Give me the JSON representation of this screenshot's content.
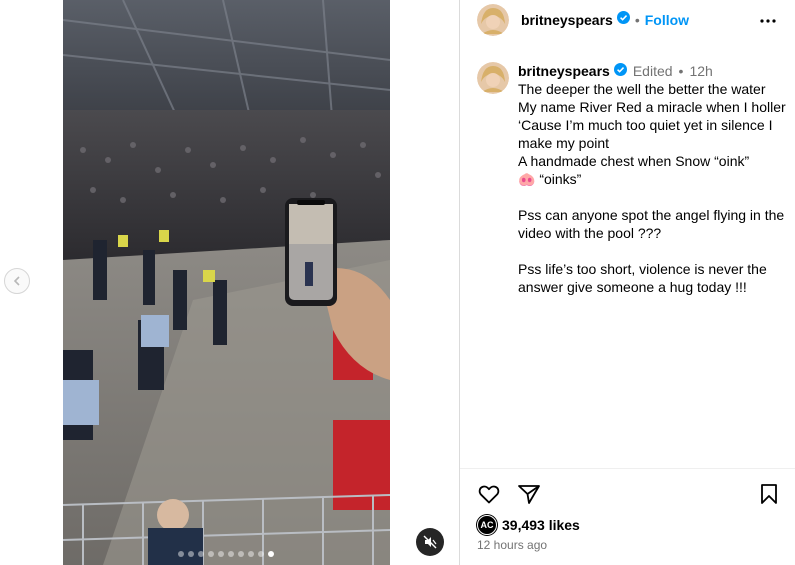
{
  "header": {
    "username": "britneyspears",
    "separator": "•",
    "follow_label": "Follow",
    "more_icon": "more-horizontal-icon"
  },
  "caption": {
    "username": "britneyspears",
    "edited_label": "Edited",
    "separator": "•",
    "time": "12h",
    "text": "The deeper the well the better the water\nMy name River Red a miracle when I holler\n‘Cause I’m much too quiet yet in silence I make my point\nA handmade chest when Snow “oink”\n🐽 “oinks”\n\nPss can anyone spot the angel flying in the video with the pool ???\n\nPss life’s too short, violence is never the answer give someone a hug today !!!"
  },
  "actions": {
    "like_icon": "heart-icon",
    "share_icon": "paper-plane-icon",
    "save_icon": "bookmark-icon"
  },
  "likes": {
    "badge_text": "AC",
    "count_label": "39,493 likes"
  },
  "timestamp": "12 hours ago",
  "media": {
    "carousel_count": 10,
    "carousel_active_index": 9,
    "mute_icon": "speaker-muted-icon",
    "prev_icon": "chevron-left-icon"
  },
  "colors": {
    "accent": "#0095f6",
    "verified": "#0095f6",
    "muted_text": "#737373",
    "border": "#dbdbdb"
  }
}
